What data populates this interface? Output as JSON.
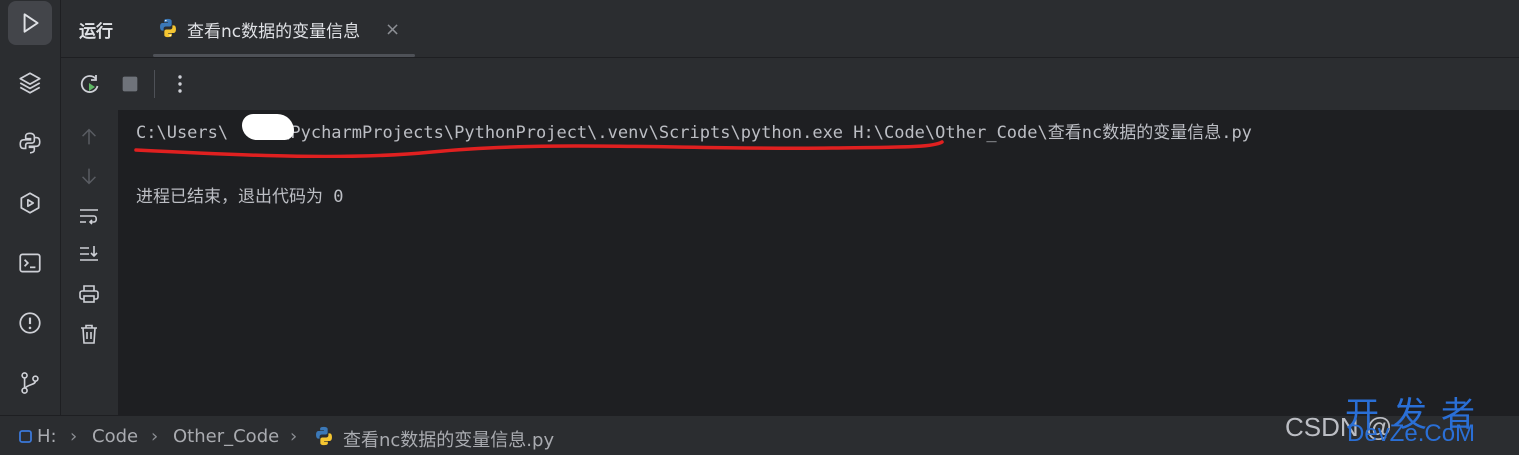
{
  "topbar": {
    "run_label": "运行",
    "tab_label": "查看nc数据的变量信息",
    "close_glyph": "×"
  },
  "console": {
    "command_prefix": "C:\\Users\\",
    "command_rest": "\\PycharmProjects\\PythonProject\\.venv\\Scripts\\python.exe H:\\Code\\Other_Code\\查看nc数据的变量信息.py",
    "exit_message": "进程已结束，退出代码为 0"
  },
  "statusbar": {
    "drive": "H:",
    "crumb_1": "Code",
    "crumb_2": "Other_Code",
    "file": "查看nc数据的变量信息.py",
    "chevron": "›"
  },
  "watermark": {
    "csdn": "CSDN @",
    "cn_text": "开发者",
    "en_text": "DevZe.CoM"
  },
  "colors": {
    "accent_red": "#e02020",
    "watermark_blue": "#2a6fd6",
    "python_blue": "#3b78b7",
    "python_yellow": "#f4c531"
  },
  "icons": {
    "left_bar": [
      "run-icon",
      "layers-icon",
      "python-console-icon",
      "services-icon",
      "terminal-icon",
      "problems-icon",
      "git-icon"
    ],
    "toolbar": [
      "rerun-icon",
      "stop-icon",
      "more-icon"
    ],
    "side_tools": [
      "up-arrow-icon",
      "down-arrow-icon",
      "soft-wrap-icon",
      "scroll-to-end-icon",
      "print-icon",
      "trash-icon"
    ]
  }
}
